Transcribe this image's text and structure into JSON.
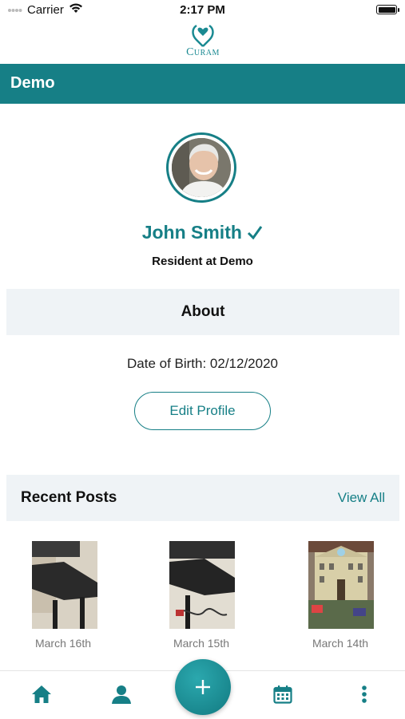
{
  "status_bar": {
    "carrier": "Carrier",
    "time": "2:17 PM"
  },
  "logo": {
    "text": "URAM",
    "icon": "curam-logo-icon"
  },
  "header": {
    "title": "Demo"
  },
  "profile": {
    "name": "John Smith",
    "verified_icon": "check-icon",
    "subtitle": "Resident at Demo"
  },
  "about": {
    "heading": "About",
    "date_of_birth": "Date of Birth: 02/12/2020",
    "edit_button": "Edit Profile"
  },
  "recent_posts": {
    "heading": "Recent Posts",
    "view_all": "View All",
    "posts": [
      {
        "date": "March 16th"
      },
      {
        "date": "March 15th"
      },
      {
        "date": "March 14th"
      }
    ]
  },
  "tab_bar": {
    "icons": [
      "home-icon",
      "profile-icon",
      "plus-icon",
      "calendar-icon",
      "more-icon"
    ]
  },
  "colors": {
    "accent": "#167f86",
    "section_bg": "#eff3f6"
  }
}
